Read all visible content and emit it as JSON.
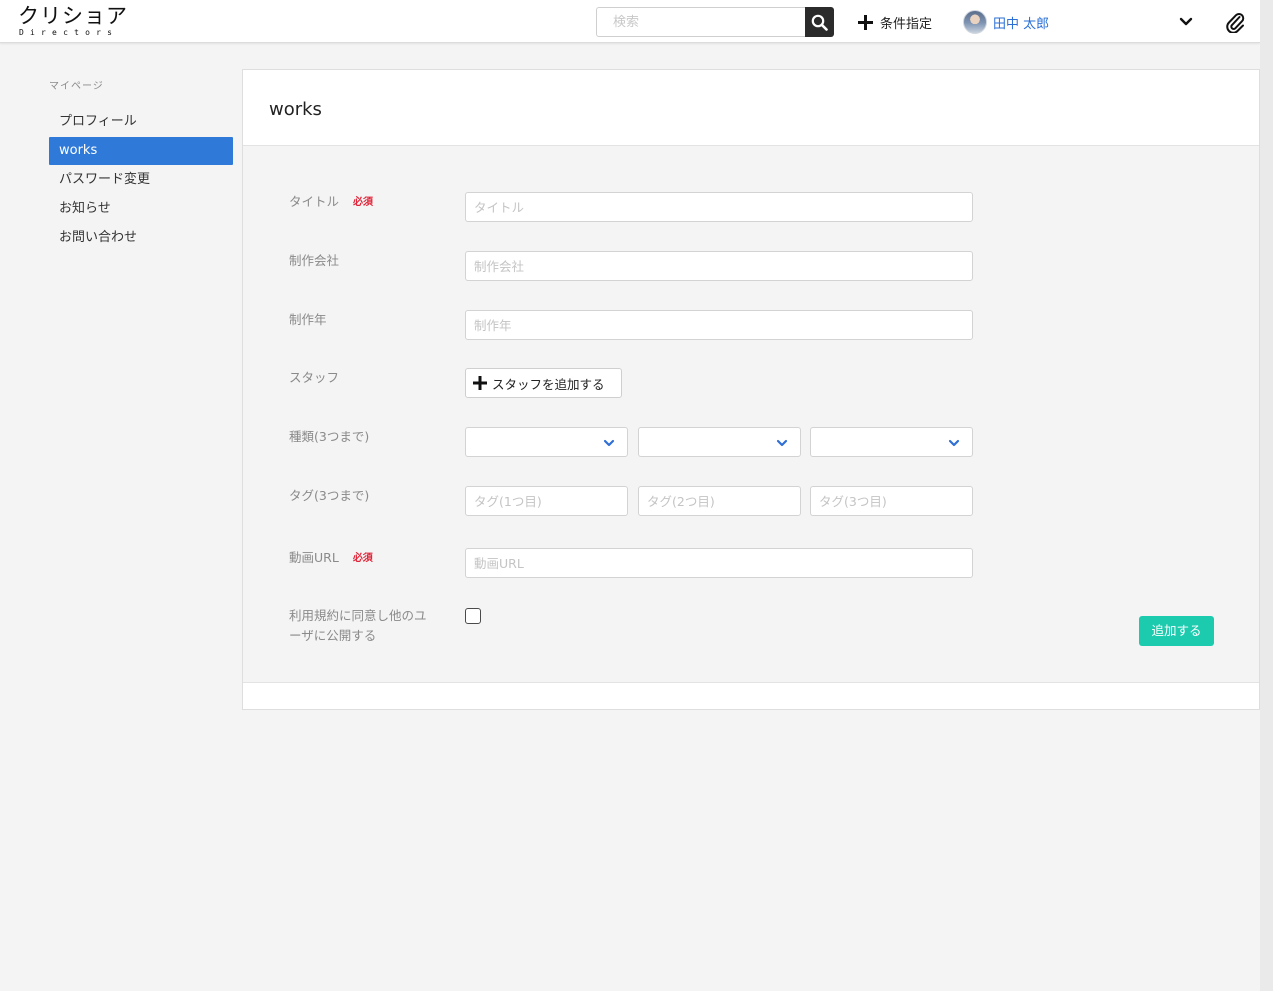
{
  "header": {
    "logo_main": "クリショア",
    "logo_sub": "Directors",
    "search_placeholder": "検索",
    "conditions_label": "条件指定",
    "user_name": "田中 太郎"
  },
  "sidebar": {
    "heading": "マイページ",
    "items": [
      {
        "label": "プロフィール"
      },
      {
        "label": "works"
      },
      {
        "label": "パスワード変更"
      },
      {
        "label": "お知らせ"
      },
      {
        "label": "お問い合わせ"
      }
    ]
  },
  "main": {
    "title": "works",
    "required_badge": "必須",
    "fields": {
      "title": {
        "label": "タイトル",
        "placeholder": "タイトル"
      },
      "company": {
        "label": "制作会社",
        "placeholder": "制作会社"
      },
      "year": {
        "label": "制作年",
        "placeholder": "制作年"
      },
      "staff": {
        "label": "スタッフ",
        "button": "スタッフを追加する"
      },
      "kinds": {
        "label": "種類(3つまで)"
      },
      "tags": {
        "label": "タグ(3つまで)",
        "placeholders": [
          "タグ(1つ目)",
          "タグ(2つ目)",
          "タグ(3つ目)"
        ]
      },
      "video_url": {
        "label": "動画URL",
        "placeholder": "動画URL"
      },
      "terms": {
        "label": "利用規約に同意し他のユーザに公開する"
      }
    },
    "submit_label": "追加する"
  },
  "colors": {
    "accent": "#2f7ad8",
    "submit": "#1ccbae",
    "required": "#e0263a",
    "search_button": "#2b2b2b"
  }
}
